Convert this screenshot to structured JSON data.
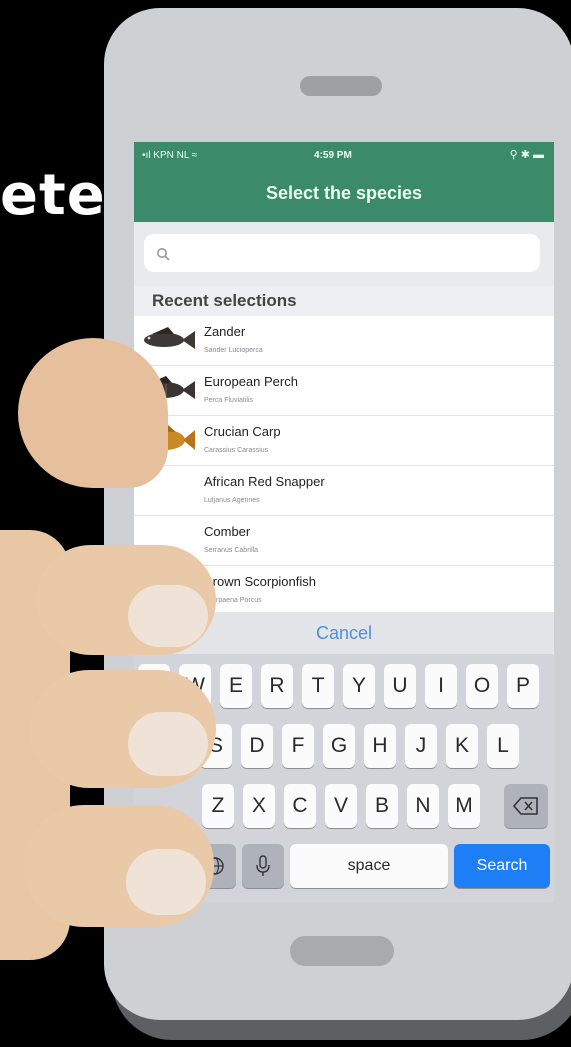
{
  "headline": "ete",
  "status": {
    "carrier": "•ıl KPN NL ≈",
    "time": "4:59 PM",
    "right": "⚲ ✱ ▬"
  },
  "title": "Select the species",
  "search": {
    "placeholder": ""
  },
  "section_header": "Recent selections",
  "items": [
    {
      "name": "Zander",
      "scientific": "Sander Lucioperca",
      "image": "fish-dark"
    },
    {
      "name": "European Perch",
      "scientific": "Perca Fluviatilis",
      "image": "fish-dark"
    },
    {
      "name": "Crucian Carp",
      "scientific": "Carassius Carassius",
      "image": "fish-gold"
    },
    {
      "name": "African Red Snapper",
      "scientific": "Lutjanus Agennes",
      "image": ""
    },
    {
      "name": "Comber",
      "scientific": "Serranus Cabrilla",
      "image": ""
    },
    {
      "name": "Brown Scorpionfish",
      "scientific": "Scorpaena Porcus",
      "image": ""
    }
  ],
  "cancel": "Cancel",
  "keyboard": {
    "row1": [
      "Q",
      "W",
      "E",
      "R",
      "T",
      "Y",
      "U",
      "I",
      "O",
      "P"
    ],
    "row2": [
      "S",
      "D",
      "F",
      "G",
      "H",
      "J",
      "K",
      "L"
    ],
    "row3": [
      "Z",
      "X",
      "C",
      "V",
      "B",
      "N",
      "M"
    ],
    "space": "space",
    "search": "Search"
  },
  "colors": {
    "header_green": "#3b8a6a",
    "search_key_blue": "#1e7ef5",
    "cancel_blue": "#4d8fe0"
  }
}
